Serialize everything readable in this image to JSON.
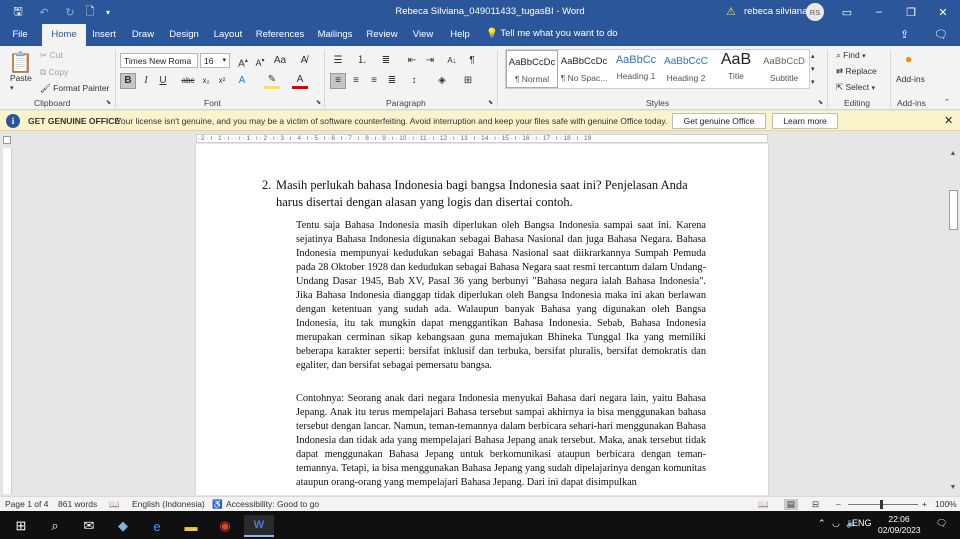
{
  "window": {
    "title": "Rebeca Silviana_049011433_tugasBI  -  Word",
    "user_name": "rebeca silviana",
    "user_initials": "RS"
  },
  "menu_tabs": [
    "File",
    "Home",
    "Insert",
    "Draw",
    "Design",
    "Layout",
    "References",
    "Mailings",
    "Review",
    "View",
    "Help"
  ],
  "active_tab": "Home",
  "tell_me": "Tell me what you want to do",
  "ribbon": {
    "clipboard": {
      "paste": "Paste",
      "cut": "Cut",
      "copy": "Copy",
      "format_painter": "Format Painter",
      "label": "Clipboard"
    },
    "font": {
      "family": "Times New Roma",
      "size": "16",
      "label": "Font"
    },
    "paragraph": {
      "label": "Paragraph"
    },
    "styles": {
      "label": "Styles",
      "items": [
        {
          "preview": "AaBbCcDc",
          "name": "¶ Normal"
        },
        {
          "preview": "AaBbCcDc",
          "name": "¶ No Spac..."
        },
        {
          "preview": "AaBbCc",
          "name": "Heading 1"
        },
        {
          "preview": "AaBbCcC",
          "name": "Heading 2"
        },
        {
          "preview": "AaB",
          "name": "Title"
        },
        {
          "preview": "AaBbCcD",
          "name": "Subtitle"
        }
      ]
    },
    "editing": {
      "find": "Find",
      "replace": "Replace",
      "select": "Select",
      "label": "Editing"
    },
    "addins": {
      "button": "Add-ins",
      "label": "Add-ins"
    }
  },
  "infobar": {
    "heading": "GET GENUINE OFFICE",
    "message": "Your license isn't genuine, and you may be a victim of software counterfeiting. Avoid interruption and keep your files safe with genuine Office today.",
    "primary_button": "Get genuine Office",
    "secondary_button": "Learn more"
  },
  "ruler_text": "· 2 · ı · 1 · ı ·   · ı · 1 · ı · 2 · ı · 3 · ı · 4 · ı · 5 · ı · 6 · ı · 7 · ı · 8 · ı · 9 · ı · 10 · ı · 11 · ı · 12 · ı · 13 · ı · 14 · ı · 15 · ı · 16 · ı · 17 · ı · 18 · ı · 19",
  "document": {
    "question_number": "2.",
    "question": "Masih perlukah bahasa Indonesia bagi bangsa Indonesia saat ini? Penjelasan Anda harus disertai dengan alasan yang logis dan disertai contoh.",
    "paragraph1": "Tentu saja Bahasa Indonesia masih diperlukan oleh Bangsa Indonesia sampai saat ini. Karena sejatinya Bahasa Indonesia digunakan sebagai Bahasa Nasional dan juga Bahasa Negara. Bahasa Indonesia mempunyai kedudukan sebagai Bahasa Nasional saat diikrarkannya Sumpah Pemuda pada 28 Oktober 1928 dan kedudukan sebagai Bahasa Negara saat resmi tercantum dalam Undang-Undang Dasar 1945, Bab XV, Pasal 36 yang berbunyi \"Bahasa negara ialah Bahasa Indonesia\". Jika Bahasa Indonesia dianggap tidak diperlukan oleh Bangsa Indonesia maka ini akan berlawan dengan ketentuan yang sudah ada. Walaupun banyak Bahasa yang digunakan oleh Bangsa Indonesia, itu tak mungkin dapat menggantikan Bahasa Indonesia. Sebab, Bahasa Indonesia merupakan cerminan sikap kebangsaan guna memajukan Bhineka Tunggal Ika yang memiliki beberapa karakter seperti: bersifat inklusif dan terbuka, bersifat pluralis, bersifat demokratis dan egaliter, dan bersifat sebagai pemersatu bangsa.",
    "paragraph2": "Contohnya: Seorang anak dari negara Indonesia menyukai Bahasa dari negara lain, yaitu Bahasa Jepang. Anak itu terus mempelajari Bahasa tersebut sampai akhirnya ia bisa menggunakan bahasa tersebut dengan lancar. Namun, teman-temannya dalam berbicara sehari-hari menggunakan Bahasa Indonesia dan tidak ada yang mempelajari Bahasa Jepang anak tersebut. Maka, anak tersebut tidak dapat menggunakan Bahasa Jepang untuk berkomunikasi ataupun berbicara dengan teman-temannya. Tetapi, ia bisa menggunakan Bahasa Jepang yang sudah dipelajarinya dengan komunitas ataupun orang-orang yang mempelajari Bahasa Jepang. Dari ini dapat disimpulkan"
  },
  "status": {
    "page": "Page 1 of 4",
    "words": "861 words",
    "language": "English (Indonesia)",
    "accessibility": "Accessibility: Good to go",
    "zoom": "100%"
  },
  "taskbar": {
    "lang": "ENG",
    "time": "22:06",
    "date": "02/09/2023"
  }
}
